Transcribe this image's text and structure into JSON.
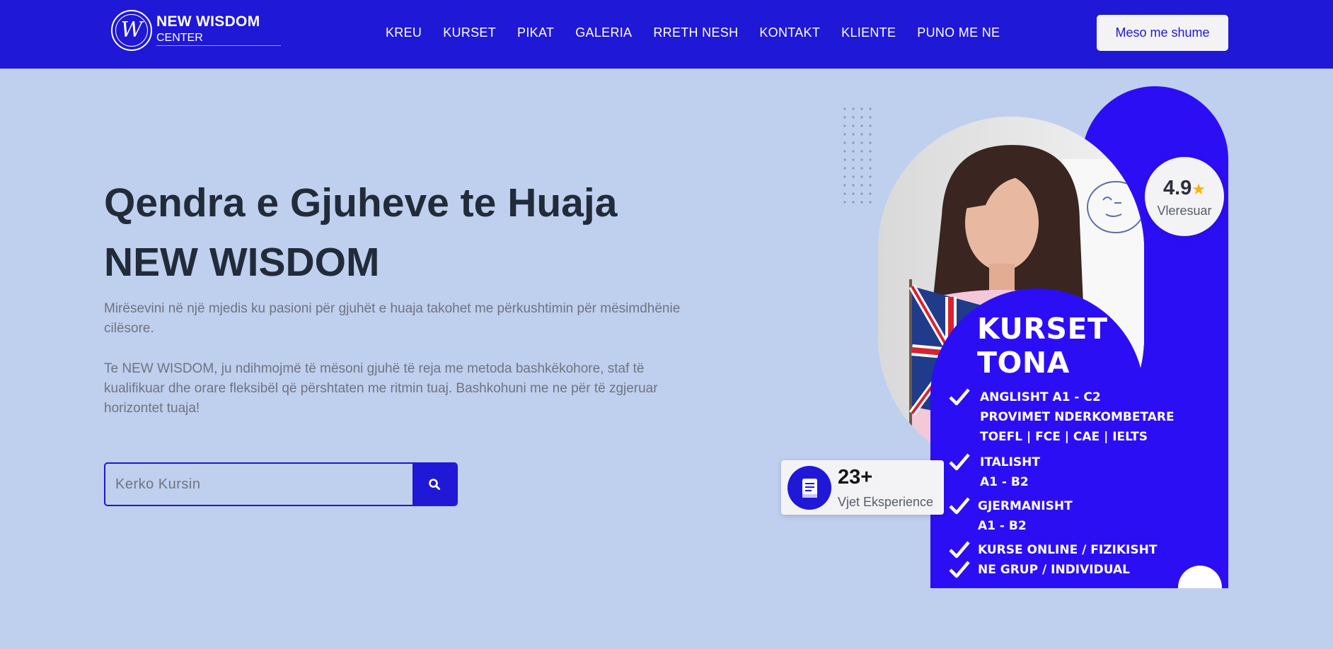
{
  "brand": {
    "name": "NEW WISDOM",
    "sub": "CENTER",
    "mark": "W"
  },
  "nav": {
    "items": [
      "KREU",
      "KURSET",
      "PIKAT",
      "GALERIA",
      "RRETH NESH",
      "KONTAKT",
      "KLIENTE",
      "PUNO ME NE"
    ],
    "cta_label": "Meso me shume"
  },
  "hero": {
    "title_line1": "Qendra e Gjuheve te Huaja",
    "title_line2": "NEW WISDOM",
    "paragraph1": "Mirësevini në një mjedis ku pasioni për gjuhët e huaja takohet me përkushtimin për mësimdhënie cilësore.",
    "paragraph2": "Te NEW WISDOM, ju ndihmojmë të mësoni gjuhë të reja me metoda bashkëkohore, staf të kualifikuar dhe orare fleksibël që përshtaten me ritmin tuaj. Bashkohuni me ne për të zgjeruar horizontet tuaja!"
  },
  "search": {
    "placeholder": "Kerko Kursin",
    "value": ""
  },
  "rating": {
    "value": "4.9",
    "star": "★",
    "label": "Vleresuar"
  },
  "courses": {
    "title_line1": "KURSET",
    "title_line2": "TONA",
    "items": [
      "ANGLISHT A1 - C2\nPROVIMET NDERKOMBETARE\nTOEFL | FCE | CAE | IELTS",
      "ITALISHT\nA1 - B2",
      "GJERMANISHT\nA1 - B2",
      "KURSE ONLINE / FIZIKISHT",
      "NE GRUP / INDIVIDUAL"
    ]
  },
  "experience": {
    "number": "23+",
    "label": "Vjet Eksperience"
  },
  "colors": {
    "brand_blue": "#1f18d6",
    "panel_blue": "#2c0ef5",
    "hero_bg": "#bfcfee",
    "star": "#f5b400"
  },
  "icons": [
    "search-icon",
    "book-icon",
    "check-icon",
    "star-icon"
  ]
}
